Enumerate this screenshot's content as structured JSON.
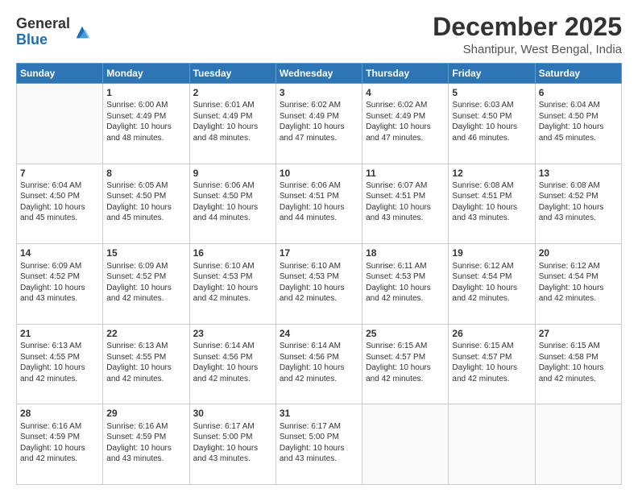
{
  "header": {
    "logo_line1": "General",
    "logo_line2": "Blue",
    "title": "December 2025",
    "location": "Shantipur, West Bengal, India"
  },
  "weekdays": [
    "Sunday",
    "Monday",
    "Tuesday",
    "Wednesday",
    "Thursday",
    "Friday",
    "Saturday"
  ],
  "weeks": [
    [
      {
        "day": "",
        "content": ""
      },
      {
        "day": "1",
        "content": "Sunrise: 6:00 AM\nSunset: 4:49 PM\nDaylight: 10 hours\nand 48 minutes."
      },
      {
        "day": "2",
        "content": "Sunrise: 6:01 AM\nSunset: 4:49 PM\nDaylight: 10 hours\nand 48 minutes."
      },
      {
        "day": "3",
        "content": "Sunrise: 6:02 AM\nSunset: 4:49 PM\nDaylight: 10 hours\nand 47 minutes."
      },
      {
        "day": "4",
        "content": "Sunrise: 6:02 AM\nSunset: 4:49 PM\nDaylight: 10 hours\nand 47 minutes."
      },
      {
        "day": "5",
        "content": "Sunrise: 6:03 AM\nSunset: 4:50 PM\nDaylight: 10 hours\nand 46 minutes."
      },
      {
        "day": "6",
        "content": "Sunrise: 6:04 AM\nSunset: 4:50 PM\nDaylight: 10 hours\nand 45 minutes."
      }
    ],
    [
      {
        "day": "7",
        "content": "Sunrise: 6:04 AM\nSunset: 4:50 PM\nDaylight: 10 hours\nand 45 minutes."
      },
      {
        "day": "8",
        "content": "Sunrise: 6:05 AM\nSunset: 4:50 PM\nDaylight: 10 hours\nand 45 minutes."
      },
      {
        "day": "9",
        "content": "Sunrise: 6:06 AM\nSunset: 4:50 PM\nDaylight: 10 hours\nand 44 minutes."
      },
      {
        "day": "10",
        "content": "Sunrise: 6:06 AM\nSunset: 4:51 PM\nDaylight: 10 hours\nand 44 minutes."
      },
      {
        "day": "11",
        "content": "Sunrise: 6:07 AM\nSunset: 4:51 PM\nDaylight: 10 hours\nand 43 minutes."
      },
      {
        "day": "12",
        "content": "Sunrise: 6:08 AM\nSunset: 4:51 PM\nDaylight: 10 hours\nand 43 minutes."
      },
      {
        "day": "13",
        "content": "Sunrise: 6:08 AM\nSunset: 4:52 PM\nDaylight: 10 hours\nand 43 minutes."
      }
    ],
    [
      {
        "day": "14",
        "content": "Sunrise: 6:09 AM\nSunset: 4:52 PM\nDaylight: 10 hours\nand 43 minutes."
      },
      {
        "day": "15",
        "content": "Sunrise: 6:09 AM\nSunset: 4:52 PM\nDaylight: 10 hours\nand 42 minutes."
      },
      {
        "day": "16",
        "content": "Sunrise: 6:10 AM\nSunset: 4:53 PM\nDaylight: 10 hours\nand 42 minutes."
      },
      {
        "day": "17",
        "content": "Sunrise: 6:10 AM\nSunset: 4:53 PM\nDaylight: 10 hours\nand 42 minutes."
      },
      {
        "day": "18",
        "content": "Sunrise: 6:11 AM\nSunset: 4:53 PM\nDaylight: 10 hours\nand 42 minutes."
      },
      {
        "day": "19",
        "content": "Sunrise: 6:12 AM\nSunset: 4:54 PM\nDaylight: 10 hours\nand 42 minutes."
      },
      {
        "day": "20",
        "content": "Sunrise: 6:12 AM\nSunset: 4:54 PM\nDaylight: 10 hours\nand 42 minutes."
      }
    ],
    [
      {
        "day": "21",
        "content": "Sunrise: 6:13 AM\nSunset: 4:55 PM\nDaylight: 10 hours\nand 42 minutes."
      },
      {
        "day": "22",
        "content": "Sunrise: 6:13 AM\nSunset: 4:55 PM\nDaylight: 10 hours\nand 42 minutes."
      },
      {
        "day": "23",
        "content": "Sunrise: 6:14 AM\nSunset: 4:56 PM\nDaylight: 10 hours\nand 42 minutes."
      },
      {
        "day": "24",
        "content": "Sunrise: 6:14 AM\nSunset: 4:56 PM\nDaylight: 10 hours\nand 42 minutes."
      },
      {
        "day": "25",
        "content": "Sunrise: 6:15 AM\nSunset: 4:57 PM\nDaylight: 10 hours\nand 42 minutes."
      },
      {
        "day": "26",
        "content": "Sunrise: 6:15 AM\nSunset: 4:57 PM\nDaylight: 10 hours\nand 42 minutes."
      },
      {
        "day": "27",
        "content": "Sunrise: 6:15 AM\nSunset: 4:58 PM\nDaylight: 10 hours\nand 42 minutes."
      }
    ],
    [
      {
        "day": "28",
        "content": "Sunrise: 6:16 AM\nSunset: 4:59 PM\nDaylight: 10 hours\nand 42 minutes."
      },
      {
        "day": "29",
        "content": "Sunrise: 6:16 AM\nSunset: 4:59 PM\nDaylight: 10 hours\nand 43 minutes."
      },
      {
        "day": "30",
        "content": "Sunrise: 6:17 AM\nSunset: 5:00 PM\nDaylight: 10 hours\nand 43 minutes."
      },
      {
        "day": "31",
        "content": "Sunrise: 6:17 AM\nSunset: 5:00 PM\nDaylight: 10 hours\nand 43 minutes."
      },
      {
        "day": "",
        "content": ""
      },
      {
        "day": "",
        "content": ""
      },
      {
        "day": "",
        "content": ""
      }
    ]
  ]
}
